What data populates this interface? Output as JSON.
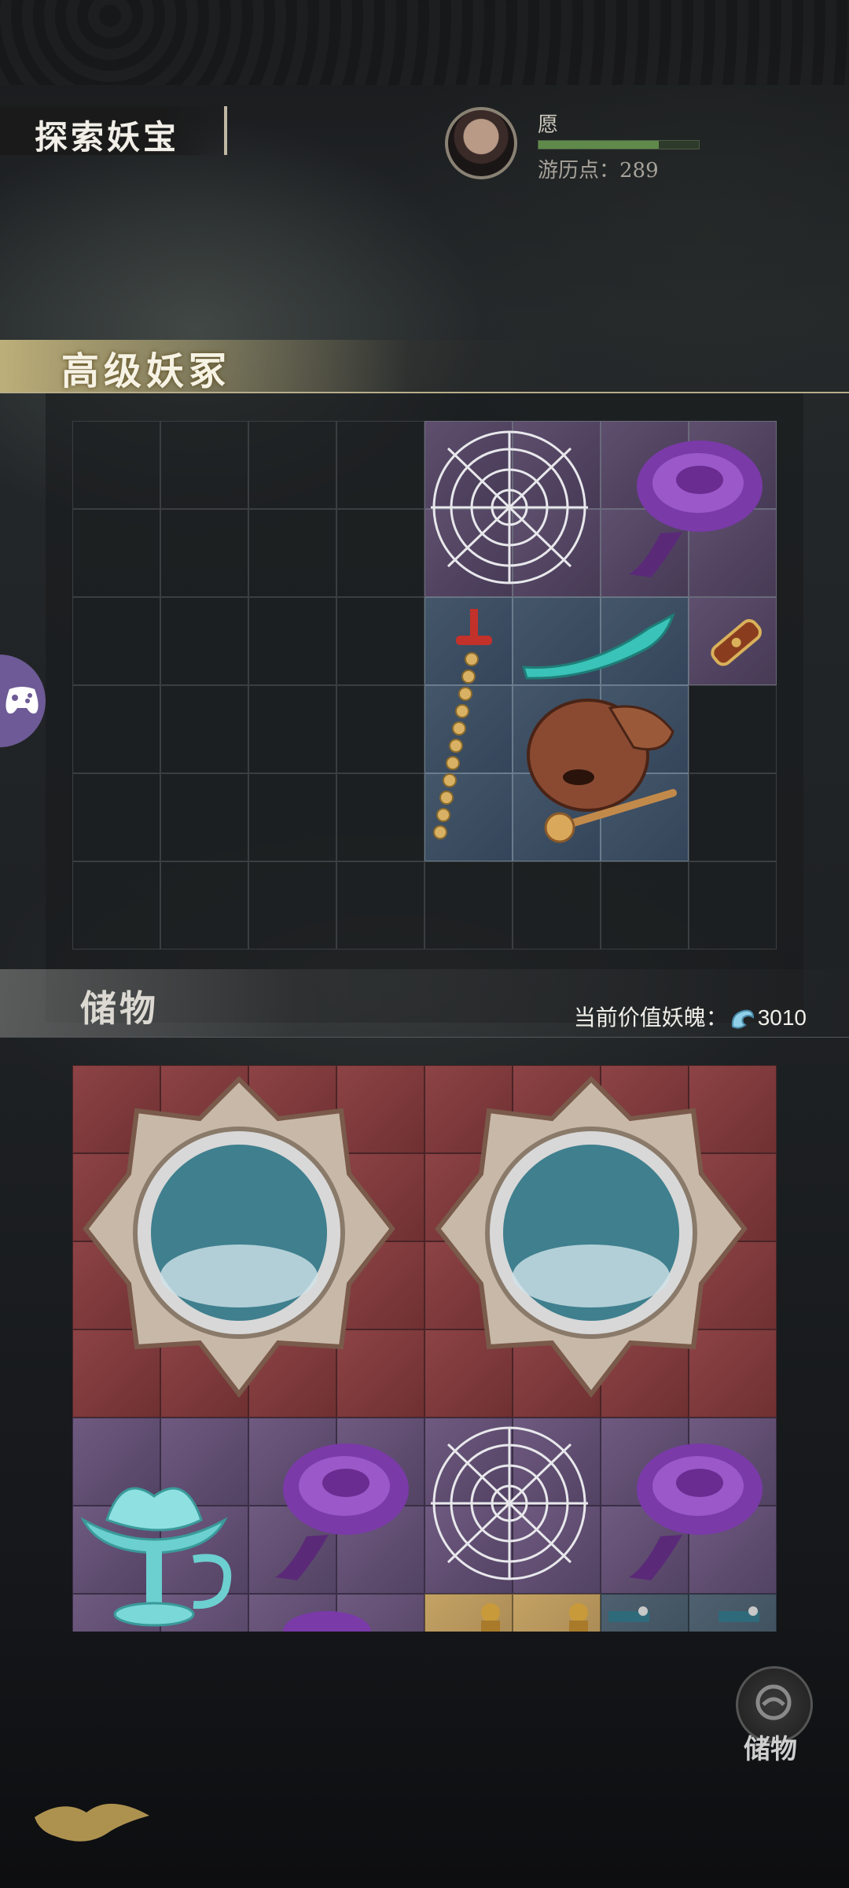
{
  "header": {
    "title": "探索妖宝"
  },
  "player": {
    "name": "愿",
    "points_label": "游历点：",
    "points": "289",
    "health_fraction": 0.75
  },
  "top_section": {
    "title": "高级妖冢"
  },
  "storage": {
    "title": "储物",
    "value_label": "当前价值妖魄：",
    "value": "3010"
  },
  "side_button": {
    "label": "储物"
  },
  "icons": {
    "player_avatar": "avatar",
    "soul_currency": "soul-icon",
    "side_left": "gamepad-icon",
    "storage": "storage-icon"
  },
  "top_grid_items": [
    "spider-web",
    "purple-lingzhi",
    "jade-horn",
    "bone-charm",
    "coin-sword",
    "bronze-bell"
  ],
  "storage_items": [
    "bronze-mirror",
    "bronze-mirror",
    "jade-lotus-lamp",
    "purple-lingzhi",
    "spider-web",
    "purple-lingzhi",
    "gold-buddha",
    "scroll"
  ],
  "colors": {
    "accent_gold": "#d6c586",
    "red_slot": "#8d4345",
    "purple_slot": "#6f5a80"
  }
}
